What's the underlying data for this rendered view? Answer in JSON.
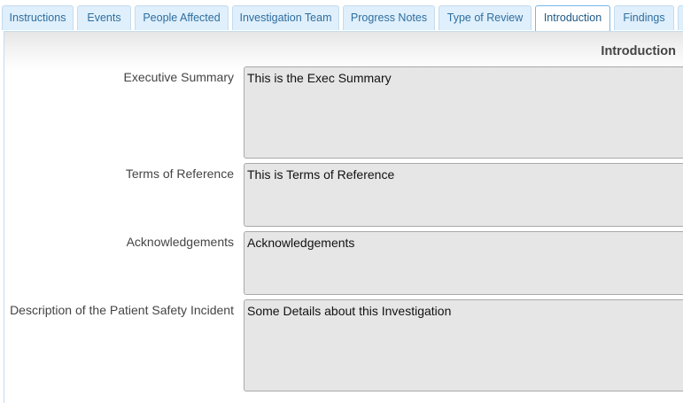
{
  "tabs": [
    {
      "label": "Instructions",
      "active": false
    },
    {
      "label": "Events",
      "active": false
    },
    {
      "label": "People Affected",
      "active": false
    },
    {
      "label": "Investigation Team",
      "active": false
    },
    {
      "label": "Progress Notes",
      "active": false
    },
    {
      "label": "Type of Review",
      "active": false
    },
    {
      "label": "Introduction",
      "active": true
    },
    {
      "label": "Findings",
      "active": false
    }
  ],
  "section": {
    "title": "Introduction"
  },
  "fields": {
    "executive_summary": {
      "label": "Executive Summary",
      "value": "This is the Exec Summary"
    },
    "terms_of_reference": {
      "label": "Terms of Reference",
      "value": "This is Terms of Reference"
    },
    "acknowledgements": {
      "label": "Acknowledgements",
      "value": "Acknowledgements"
    },
    "incident_description": {
      "label": "Description of the Patient Safety Incident",
      "value": "Some Details about this Investigation"
    }
  },
  "colors": {
    "tab_background": "#dfeffc",
    "tab_text": "#2e6e9e",
    "field_background": "#e6e6e6"
  }
}
